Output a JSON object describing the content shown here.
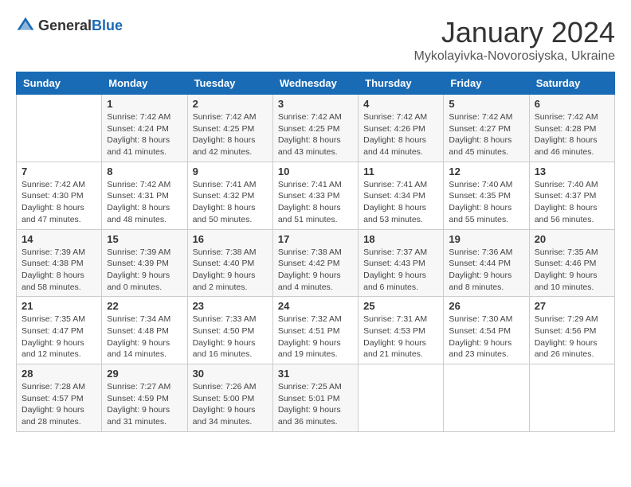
{
  "header": {
    "logo_general": "General",
    "logo_blue": "Blue",
    "month_title": "January 2024",
    "location": "Mykolayivka-Novorosiyska, Ukraine"
  },
  "weekdays": [
    "Sunday",
    "Monday",
    "Tuesday",
    "Wednesday",
    "Thursday",
    "Friday",
    "Saturday"
  ],
  "weeks": [
    [
      {
        "day": "",
        "sunrise": "",
        "sunset": "",
        "daylight": ""
      },
      {
        "day": "1",
        "sunrise": "Sunrise: 7:42 AM",
        "sunset": "Sunset: 4:24 PM",
        "daylight": "Daylight: 8 hours and 41 minutes."
      },
      {
        "day": "2",
        "sunrise": "Sunrise: 7:42 AM",
        "sunset": "Sunset: 4:25 PM",
        "daylight": "Daylight: 8 hours and 42 minutes."
      },
      {
        "day": "3",
        "sunrise": "Sunrise: 7:42 AM",
        "sunset": "Sunset: 4:25 PM",
        "daylight": "Daylight: 8 hours and 43 minutes."
      },
      {
        "day": "4",
        "sunrise": "Sunrise: 7:42 AM",
        "sunset": "Sunset: 4:26 PM",
        "daylight": "Daylight: 8 hours and 44 minutes."
      },
      {
        "day": "5",
        "sunrise": "Sunrise: 7:42 AM",
        "sunset": "Sunset: 4:27 PM",
        "daylight": "Daylight: 8 hours and 45 minutes."
      },
      {
        "day": "6",
        "sunrise": "Sunrise: 7:42 AM",
        "sunset": "Sunset: 4:28 PM",
        "daylight": "Daylight: 8 hours and 46 minutes."
      }
    ],
    [
      {
        "day": "7",
        "sunrise": "Sunrise: 7:42 AM",
        "sunset": "Sunset: 4:30 PM",
        "daylight": "Daylight: 8 hours and 47 minutes."
      },
      {
        "day": "8",
        "sunrise": "Sunrise: 7:42 AM",
        "sunset": "Sunset: 4:31 PM",
        "daylight": "Daylight: 8 hours and 48 minutes."
      },
      {
        "day": "9",
        "sunrise": "Sunrise: 7:41 AM",
        "sunset": "Sunset: 4:32 PM",
        "daylight": "Daylight: 8 hours and 50 minutes."
      },
      {
        "day": "10",
        "sunrise": "Sunrise: 7:41 AM",
        "sunset": "Sunset: 4:33 PM",
        "daylight": "Daylight: 8 hours and 51 minutes."
      },
      {
        "day": "11",
        "sunrise": "Sunrise: 7:41 AM",
        "sunset": "Sunset: 4:34 PM",
        "daylight": "Daylight: 8 hours and 53 minutes."
      },
      {
        "day": "12",
        "sunrise": "Sunrise: 7:40 AM",
        "sunset": "Sunset: 4:35 PM",
        "daylight": "Daylight: 8 hours and 55 minutes."
      },
      {
        "day": "13",
        "sunrise": "Sunrise: 7:40 AM",
        "sunset": "Sunset: 4:37 PM",
        "daylight": "Daylight: 8 hours and 56 minutes."
      }
    ],
    [
      {
        "day": "14",
        "sunrise": "Sunrise: 7:39 AM",
        "sunset": "Sunset: 4:38 PM",
        "daylight": "Daylight: 8 hours and 58 minutes."
      },
      {
        "day": "15",
        "sunrise": "Sunrise: 7:39 AM",
        "sunset": "Sunset: 4:39 PM",
        "daylight": "Daylight: 9 hours and 0 minutes."
      },
      {
        "day": "16",
        "sunrise": "Sunrise: 7:38 AM",
        "sunset": "Sunset: 4:40 PM",
        "daylight": "Daylight: 9 hours and 2 minutes."
      },
      {
        "day": "17",
        "sunrise": "Sunrise: 7:38 AM",
        "sunset": "Sunset: 4:42 PM",
        "daylight": "Daylight: 9 hours and 4 minutes."
      },
      {
        "day": "18",
        "sunrise": "Sunrise: 7:37 AM",
        "sunset": "Sunset: 4:43 PM",
        "daylight": "Daylight: 9 hours and 6 minutes."
      },
      {
        "day": "19",
        "sunrise": "Sunrise: 7:36 AM",
        "sunset": "Sunset: 4:44 PM",
        "daylight": "Daylight: 9 hours and 8 minutes."
      },
      {
        "day": "20",
        "sunrise": "Sunrise: 7:35 AM",
        "sunset": "Sunset: 4:46 PM",
        "daylight": "Daylight: 9 hours and 10 minutes."
      }
    ],
    [
      {
        "day": "21",
        "sunrise": "Sunrise: 7:35 AM",
        "sunset": "Sunset: 4:47 PM",
        "daylight": "Daylight: 9 hours and 12 minutes."
      },
      {
        "day": "22",
        "sunrise": "Sunrise: 7:34 AM",
        "sunset": "Sunset: 4:48 PM",
        "daylight": "Daylight: 9 hours and 14 minutes."
      },
      {
        "day": "23",
        "sunrise": "Sunrise: 7:33 AM",
        "sunset": "Sunset: 4:50 PM",
        "daylight": "Daylight: 9 hours and 16 minutes."
      },
      {
        "day": "24",
        "sunrise": "Sunrise: 7:32 AM",
        "sunset": "Sunset: 4:51 PM",
        "daylight": "Daylight: 9 hours and 19 minutes."
      },
      {
        "day": "25",
        "sunrise": "Sunrise: 7:31 AM",
        "sunset": "Sunset: 4:53 PM",
        "daylight": "Daylight: 9 hours and 21 minutes."
      },
      {
        "day": "26",
        "sunrise": "Sunrise: 7:30 AM",
        "sunset": "Sunset: 4:54 PM",
        "daylight": "Daylight: 9 hours and 23 minutes."
      },
      {
        "day": "27",
        "sunrise": "Sunrise: 7:29 AM",
        "sunset": "Sunset: 4:56 PM",
        "daylight": "Daylight: 9 hours and 26 minutes."
      }
    ],
    [
      {
        "day": "28",
        "sunrise": "Sunrise: 7:28 AM",
        "sunset": "Sunset: 4:57 PM",
        "daylight": "Daylight: 9 hours and 28 minutes."
      },
      {
        "day": "29",
        "sunrise": "Sunrise: 7:27 AM",
        "sunset": "Sunset: 4:59 PM",
        "daylight": "Daylight: 9 hours and 31 minutes."
      },
      {
        "day": "30",
        "sunrise": "Sunrise: 7:26 AM",
        "sunset": "Sunset: 5:00 PM",
        "daylight": "Daylight: 9 hours and 34 minutes."
      },
      {
        "day": "31",
        "sunrise": "Sunrise: 7:25 AM",
        "sunset": "Sunset: 5:01 PM",
        "daylight": "Daylight: 9 hours and 36 minutes."
      },
      {
        "day": "",
        "sunrise": "",
        "sunset": "",
        "daylight": ""
      },
      {
        "day": "",
        "sunrise": "",
        "sunset": "",
        "daylight": ""
      },
      {
        "day": "",
        "sunrise": "",
        "sunset": "",
        "daylight": ""
      }
    ]
  ]
}
